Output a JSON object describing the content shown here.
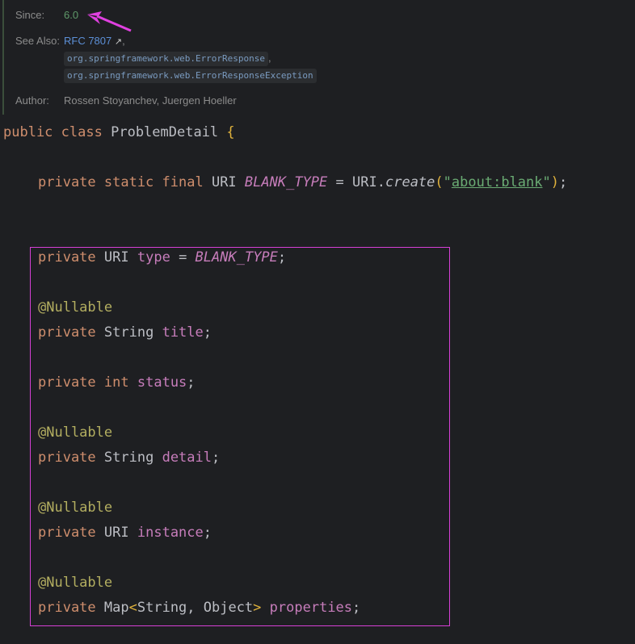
{
  "doc": {
    "since_label": "Since:",
    "since_value": "6.0",
    "see_also_label": "See Also:",
    "see_also_link": "RFC 7807",
    "see_also_link_ext": "↗",
    "see_also_items": [
      "org.springframework.web.ErrorResponse",
      "org.springframework.web.ErrorResponseException"
    ],
    "comma": ",",
    "author_label": "Author:",
    "author_value": "Rossen Stoyanchev, Juergen Hoeller"
  },
  "code": {
    "class_line": {
      "kw1": "public",
      "kw2": "class",
      "name": "ProblemDetail",
      "brace": "{"
    },
    "blank_type": {
      "mods": "private static final",
      "type": "URI",
      "name": "BLANK_TYPE",
      "eq": "=",
      "call_obj": "URI.",
      "call_fn": "create",
      "open": "(",
      "q1": "\"",
      "arg": "about:blank",
      "q2": "\"",
      "close": ")",
      "semi": ";"
    },
    "annotation": "@Nullable",
    "private_kw": "private",
    "fields": [
      {
        "type": "URI",
        "name": "type",
        "init_eq": " = ",
        "init_val": "BLANK_TYPE"
      },
      {
        "type": "String",
        "name": "title"
      },
      {
        "type": "int",
        "name": "status"
      },
      {
        "type": "String",
        "name": "detail"
      },
      {
        "type": "URI",
        "name": "instance"
      },
      {
        "type_pre": "Map",
        "lt": "<",
        "type_args": "String, Object",
        "gt": ">",
        "name": "properties"
      }
    ],
    "semi": ";"
  },
  "colors": {
    "annotation_box": "#d63fd6",
    "arrow": "#e040e0",
    "background": "#1e1f22"
  }
}
